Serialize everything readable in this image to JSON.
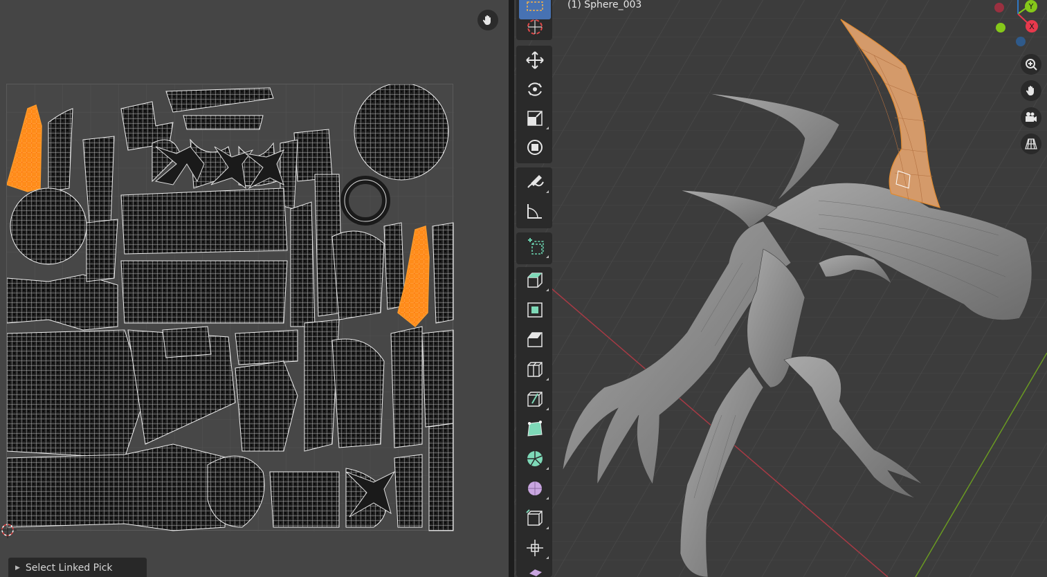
{
  "uv_editor": {
    "operator_panel_label": "Select Linked Pick"
  },
  "viewport": {
    "object_label": "(1) Sphere_003",
    "gizmo": {
      "axis_y_label": "Y",
      "axis_x_label": "X",
      "x_color": "#e8394d",
      "y_color": "#85c81a",
      "z_color": "#2f78c4"
    }
  },
  "toolbar": {
    "tools": [
      {
        "name": "select-box",
        "icon": "select-box-icon",
        "active": true
      },
      {
        "name": "cursor",
        "icon": "cursor-icon"
      },
      {
        "name": "move",
        "icon": "move-icon"
      },
      {
        "name": "rotate",
        "icon": "rotate-icon"
      },
      {
        "name": "scale",
        "icon": "scale-icon"
      },
      {
        "name": "transform",
        "icon": "transform-icon"
      },
      {
        "name": "annotate",
        "icon": "annotate-icon"
      },
      {
        "name": "measure",
        "icon": "measure-icon"
      },
      {
        "name": "add-cube",
        "icon": "add-cube-icon"
      },
      {
        "name": "extrude",
        "icon": "extrude-icon"
      },
      {
        "name": "inset",
        "icon": "inset-icon"
      },
      {
        "name": "bevel",
        "icon": "bevel-icon"
      },
      {
        "name": "loop-cut",
        "icon": "loop-cut-icon"
      },
      {
        "name": "knife",
        "icon": "knife-icon"
      },
      {
        "name": "poly-build",
        "icon": "poly-build-icon"
      },
      {
        "name": "spin",
        "icon": "spin-icon"
      },
      {
        "name": "smooth",
        "icon": "smooth-icon"
      },
      {
        "name": "edge-slide",
        "icon": "edge-slide-icon"
      },
      {
        "name": "shrink-fatten",
        "icon": "shrink-fatten-icon"
      },
      {
        "name": "shear",
        "icon": "shear-icon"
      }
    ]
  },
  "colors": {
    "selection_orange": "#ff8c1a",
    "active_tool_blue": "#4772b3",
    "mesh_selected": "#e0a060"
  }
}
